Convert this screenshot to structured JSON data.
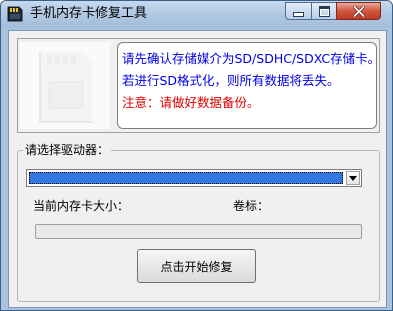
{
  "window": {
    "title": "手机内存卡修复工具"
  },
  "message": {
    "line1": "请先确认存储媒介为SD/SDHC/SDXC存储卡。",
    "line2": "若进行SD格式化，则所有数据将丢失。",
    "line3": "注意：请做好数据备份。"
  },
  "drive": {
    "group_label": "请选择驱动器：",
    "selected_value": "",
    "capacity_label": "当前内存卡大小：",
    "capacity_value": "",
    "volume_label": "卷标：",
    "volume_value": ""
  },
  "progress": {
    "value": 0
  },
  "actions": {
    "start_label": "点击开始修复"
  },
  "colors": {
    "message_info": "#0000e8",
    "message_warning": "#e00000",
    "selection": "#3179e0"
  },
  "icons": {
    "app": "sd-card-app-icon",
    "sd": "sd-card-icon"
  }
}
